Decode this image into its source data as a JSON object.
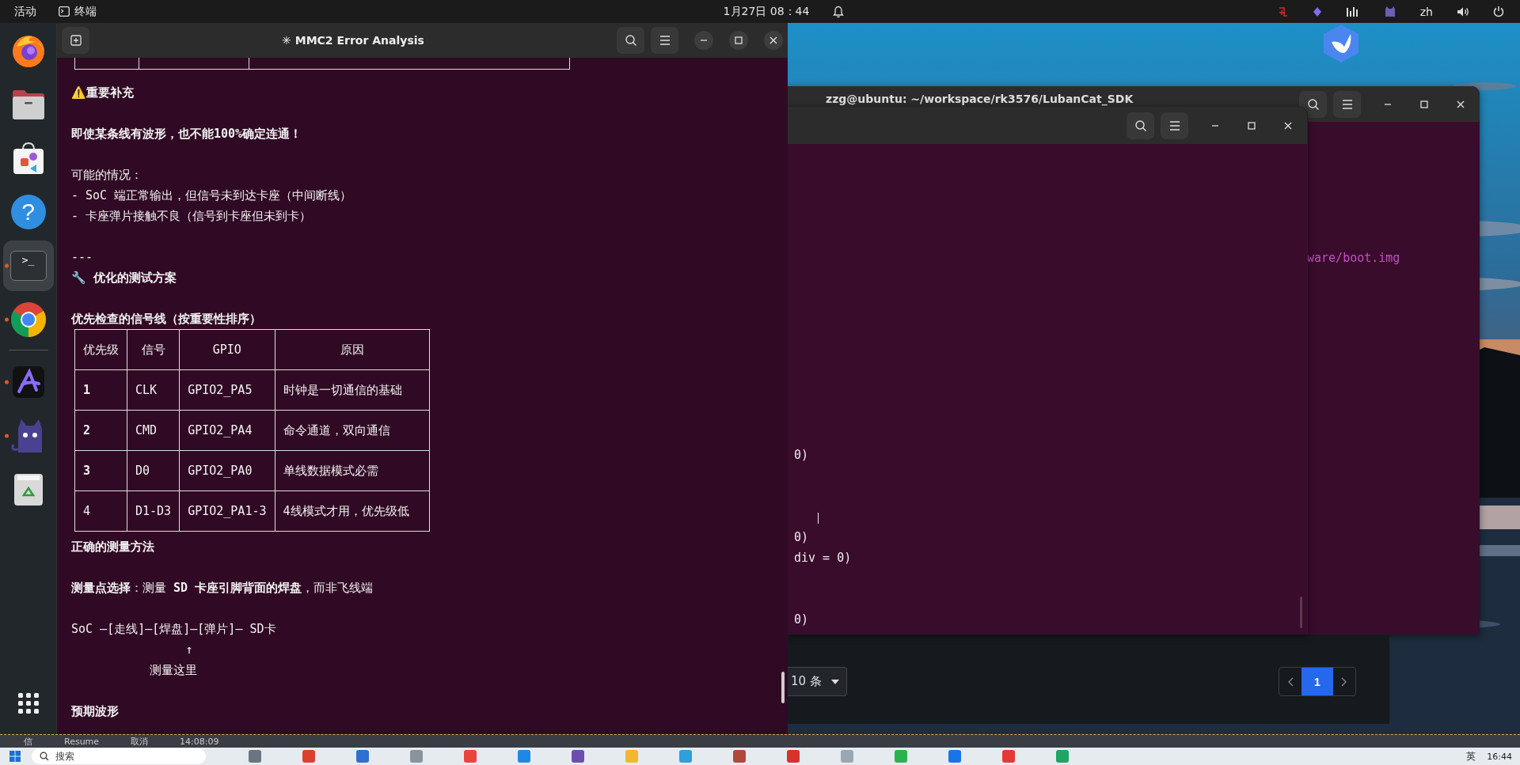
{
  "top_bar": {
    "activities": "活动",
    "app": "终端",
    "clock": "1月27日  08：44",
    "language": "zh"
  },
  "dock": {
    "favorites": [
      {
        "kind": "firefox",
        "running": false,
        "selected": false
      },
      {
        "kind": "files",
        "running": false,
        "selected": false
      },
      {
        "kind": "store",
        "running": false,
        "selected": false
      },
      {
        "kind": "help",
        "glyph": "?",
        "running": false,
        "selected": false
      },
      {
        "kind": "terminal",
        "glyph": ">_",
        "running": true,
        "selected": true
      },
      {
        "kind": "chrome",
        "running": true,
        "selected": false
      }
    ],
    "others": [
      {
        "kind": "ai-app",
        "running": true,
        "selected": false
      },
      {
        "kind": "cat-app",
        "running": true,
        "selected": false
      },
      {
        "kind": "trash",
        "running": false,
        "selected": false
      }
    ]
  },
  "terminal": {
    "title": "✳ MMC2 Error Analysis",
    "paragraphs": [
      [
        {
          "kind": "table_end"
        },
        {
          "kind": "heading",
          "text": "⚠️重要补充"
        }
      ],
      [
        {
          "kind": "heading",
          "text": "即使某条线有波形，也不能100%确定连通！"
        }
      ],
      [
        {
          "kind": "text",
          "text": "可能的情况："
        },
        {
          "kind": "text",
          "text": "- SoC 端正常输出，但信号未到达卡座（中间断线）"
        },
        {
          "kind": "text",
          "text": "- 卡座弹片接触不良（信号到卡座但未到卡）"
        }
      ],
      [
        {
          "kind": "text",
          "text": "---"
        },
        {
          "kind": "heading",
          "text": "🔧 优化的测试方案"
        }
      ],
      [
        {
          "kind": "heading",
          "text": "优先检查的信号线（按重要性排序）"
        },
        {
          "kind": "table",
          "columns": [
            "优先级",
            "信号",
            "GPIO",
            "原因"
          ],
          "rows": [
            {
              "bold": true,
              "cells": [
                "1",
                "CLK",
                "GPIO2_PA5",
                "时钟是一切通信的基础"
              ]
            },
            {
              "bold": true,
              "cells": [
                "2",
                "CMD",
                "GPIO2_PA4",
                "命令通道，双向通信"
              ]
            },
            {
              "bold": true,
              "cells": [
                "3",
                "D0",
                "GPIO2_PA0",
                "单线数据模式必需"
              ]
            },
            {
              "bold": false,
              "cells": [
                "4",
                "D1-D3",
                "GPIO2_PA1-3",
                "4线模式才用，优先级低"
              ]
            }
          ]
        },
        {
          "kind": "heading",
          "text": "正确的测量方法"
        }
      ],
      [
        {
          "kind": "text",
          "text": "**测量点选择**：测量 **SD 卡座引脚背面的焊盘**，而非飞线端"
        }
      ],
      [
        {
          "kind": "text",
          "text": "SoC —[走线]—[焊盘]—[弹片]— SD卡"
        },
        {
          "kind": "text",
          "text": "                ↑"
        },
        {
          "kind": "text",
          "text": "           测量这里"
        }
      ],
      [
        {
          "kind": "heading",
          "text": "预期波形"
        }
      ]
    ]
  },
  "desktop": {
    "back_window": {
      "title": "zzg@ubuntu: ~/workspace/rk3576/LubanCat_SDK",
      "lines": [
        "ware/boot.img"
      ]
    },
    "front_window": {
      "groups": [
        [
          "0)"
        ],
        [
          "0)",
          "div = 0)"
        ],
        [
          "0)"
        ]
      ]
    },
    "panel": {
      "page_size": "10 条",
      "pages": [
        {
          "label": "1",
          "selected": true
        }
      ]
    }
  },
  "strip": {
    "items": [
      "信",
      "Resume",
      "取消",
      "14:08:09"
    ]
  },
  "taskbar": {
    "search": "搜索",
    "ime": "英",
    "time": "16:44",
    "apps": [
      {
        "color": "#6b7580"
      },
      {
        "color": "#d9412f"
      },
      {
        "color": "#2f6fd0"
      },
      {
        "color": "#8a939c"
      },
      {
        "color": "#e8463a"
      },
      {
        "color": "#1e88e5"
      },
      {
        "color": "#6a4fb0"
      },
      {
        "color": "#f2b632"
      },
      {
        "color": "#2e9fd8"
      },
      {
        "color": "#b0483c"
      },
      {
        "color": "#d8322a"
      },
      {
        "color": "#9aa7b3"
      },
      {
        "color": "#2bb24c"
      },
      {
        "color": "#1a73e8"
      },
      {
        "color": "#e53935"
      },
      {
        "color": "#1fa463"
      }
    ]
  }
}
